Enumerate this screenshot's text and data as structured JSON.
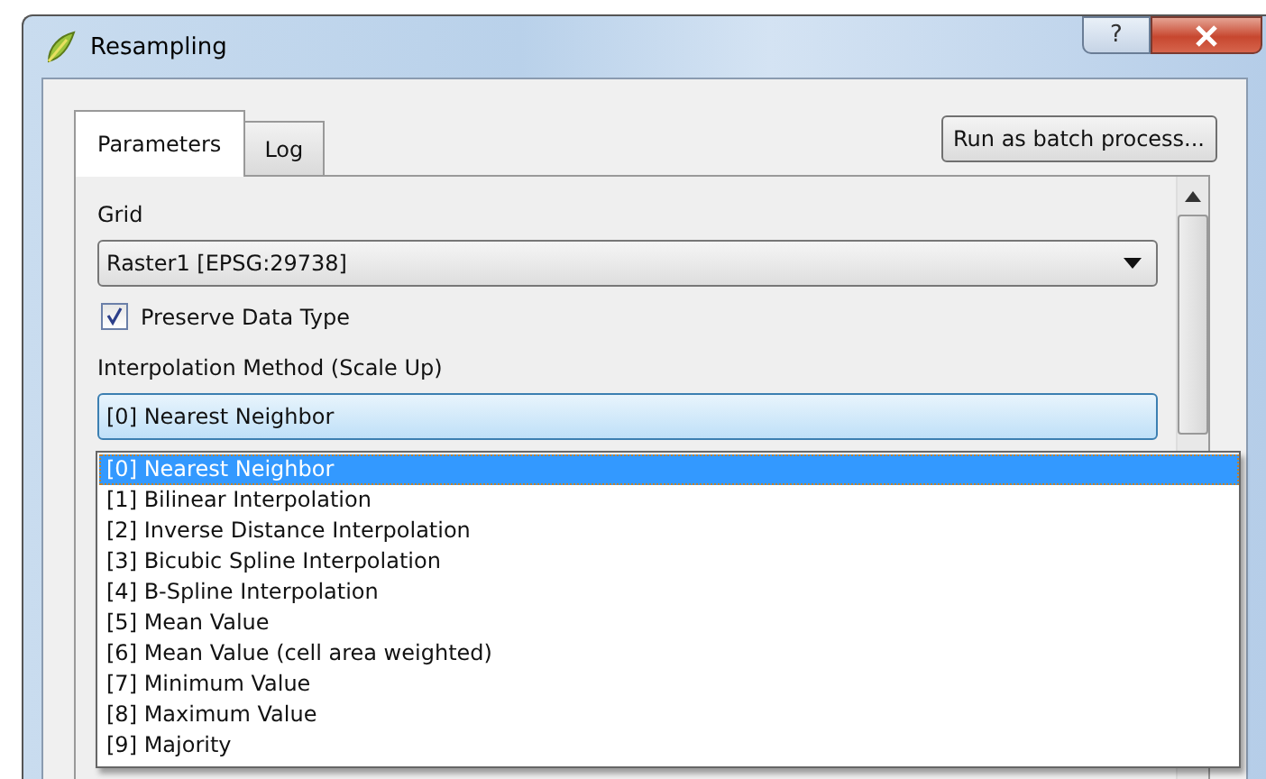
{
  "window": {
    "title": "Resampling",
    "help_button": "?"
  },
  "tabs": [
    {
      "label": "Parameters",
      "selected": true
    },
    {
      "label": "Log",
      "selected": false
    }
  ],
  "batch_button": "Run as batch process...",
  "grid": {
    "label": "Grid",
    "value": "Raster1 [EPSG:29738]"
  },
  "preserve_data_type": {
    "label": "Preserve Data Type",
    "checked": true
  },
  "interpolation": {
    "label": "Interpolation Method (Scale Up)",
    "value": "[0] Nearest Neighbor",
    "expanded": true,
    "options": [
      {
        "label": "[0] Nearest Neighbor",
        "selected": true
      },
      {
        "label": "[1] Bilinear Interpolation",
        "selected": false
      },
      {
        "label": "[2] Inverse Distance Interpolation",
        "selected": false
      },
      {
        "label": "[3] Bicubic Spline Interpolation",
        "selected": false
      },
      {
        "label": "[4] B-Spline Interpolation",
        "selected": false
      },
      {
        "label": "[5] Mean Value",
        "selected": false
      },
      {
        "label": "[6] Mean Value (cell area weighted)",
        "selected": false
      },
      {
        "label": "[7] Minimum Value",
        "selected": false
      },
      {
        "label": "[8] Maximum Value",
        "selected": false
      },
      {
        "label": "[9] Majority",
        "selected": false
      }
    ]
  }
}
